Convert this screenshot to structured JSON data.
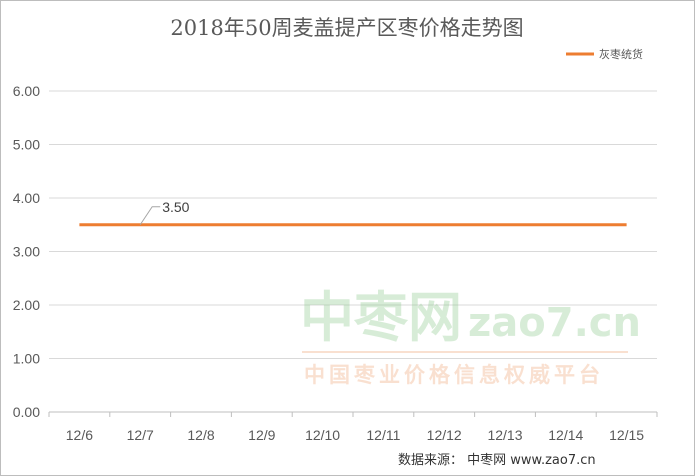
{
  "chart_data": {
    "type": "line",
    "title": "2018年50周麦盖提产区枣价格走势图",
    "categories": [
      "12/6",
      "12/7",
      "12/8",
      "12/9",
      "12/10",
      "12/11",
      "12/12",
      "12/13",
      "12/14",
      "12/15"
    ],
    "series": [
      {
        "name": "灰枣统货",
        "values": [
          3.5,
          3.5,
          3.5,
          3.5,
          3.5,
          3.5,
          3.5,
          3.5,
          3.5,
          3.5
        ],
        "color": "#ed7d31"
      }
    ],
    "data_labels": [
      {
        "index": 1,
        "text": "3.50"
      }
    ],
    "yticks": [
      "0.00",
      "1.00",
      "2.00",
      "3.00",
      "4.00",
      "5.00",
      "6.00"
    ],
    "ylim": [
      0,
      6
    ],
    "grid": true,
    "legend_position": "top-right"
  },
  "watermark": {
    "brand": "中枣网",
    "url": "zao7.cn",
    "slogan": "中国枣业价格信息权威平台"
  },
  "source": "数据来源： 中枣网 www.zao7.cn",
  "colors": {
    "grid": "#d9d9d9",
    "axis": "#bfbfbf"
  }
}
